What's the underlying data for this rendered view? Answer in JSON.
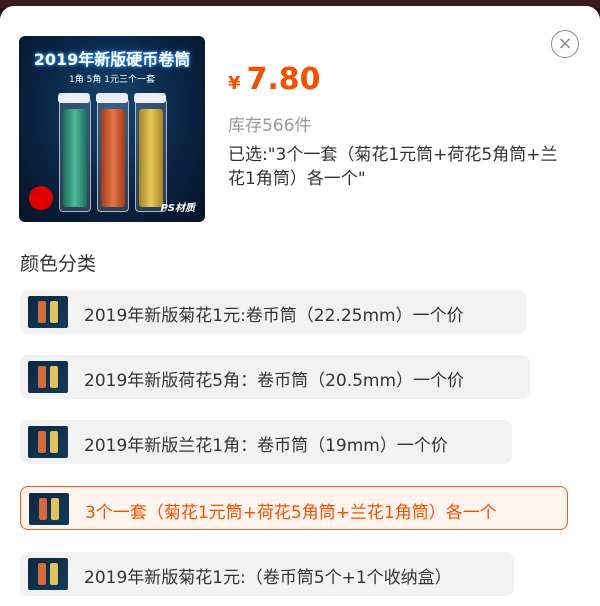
{
  "product": {
    "image_title": "2019年新版硬币卷筒",
    "image_subtitle": "1角 5角 1元三个一套",
    "image_stamp": "PS材质",
    "price_symbol": "¥",
    "price": "7.80",
    "stock": "库存566件",
    "selected": "已选:\"3个一套（菊花1元筒+荷花5角筒+兰花1角筒）各一个\""
  },
  "close_icon": "close-icon",
  "section_title": "颜色分类",
  "options": [
    {
      "label": "2019年新版菊花1元:卷币筒（22.25mm）一个价",
      "selected": false
    },
    {
      "label": "2019年新版荷花5角：卷币筒（20.5mm）一个价",
      "selected": false
    },
    {
      "label": "2019年新版兰花1角：卷币筒（19mm）一个价",
      "selected": false
    },
    {
      "label": "3个一套（菊花1元筒+荷花5角筒+兰花1角筒）各一个",
      "selected": true
    },
    {
      "label": "2019年新版菊花1元:（卷币筒5个+1个收纳盒）",
      "selected": false
    }
  ],
  "colors": {
    "accent": "#f55000",
    "chip_bg": "#f2f2f2",
    "stock_text": "#9a9a9a"
  }
}
